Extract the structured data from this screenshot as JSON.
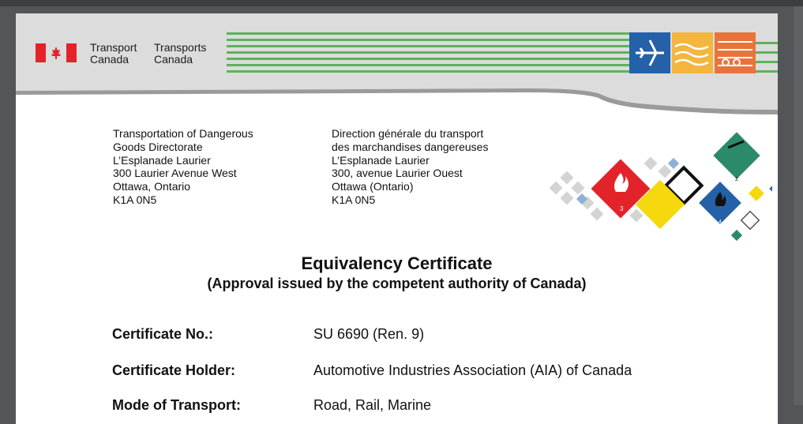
{
  "header": {
    "org_name_en": [
      "Transport",
      "Canada"
    ],
    "org_name_fr": [
      "Transports",
      "Canada"
    ],
    "colors": {
      "green": "#5ab45a",
      "blue": "#2461a8",
      "yellow": "#f4b63f",
      "orange": "#e8743b",
      "red": "#e3232a",
      "banner_gray": "#dcdcdc"
    }
  },
  "address_en": [
    "Transportation of Dangerous",
    "Goods Directorate",
    "L’Esplanade Laurier",
    "300 Laurier Avenue West",
    "Ottawa, Ontario",
    "K1A 0N5"
  ],
  "address_fr": [
    "Direction générale du transport",
    "des marchandises dangereuses",
    "L’Esplanade Laurier",
    "300, avenue Laurier Ouest",
    "Ottawa (Ontario)",
    "K1A 0N5"
  ],
  "placards": [
    "3",
    "2",
    "4"
  ],
  "title": "Equivalency Certificate",
  "subtitle": "(Approval issued by the competent authority of Canada)",
  "fields": [
    {
      "label": "Certificate No.:",
      "value": "SU 6690 (Ren. 9)"
    },
    {
      "label": "Certificate Holder:",
      "value": "Automotive Industries Association (AIA) of Canada"
    },
    {
      "label": "Mode of Transport:",
      "value": "Road, Rail, Marine"
    }
  ]
}
